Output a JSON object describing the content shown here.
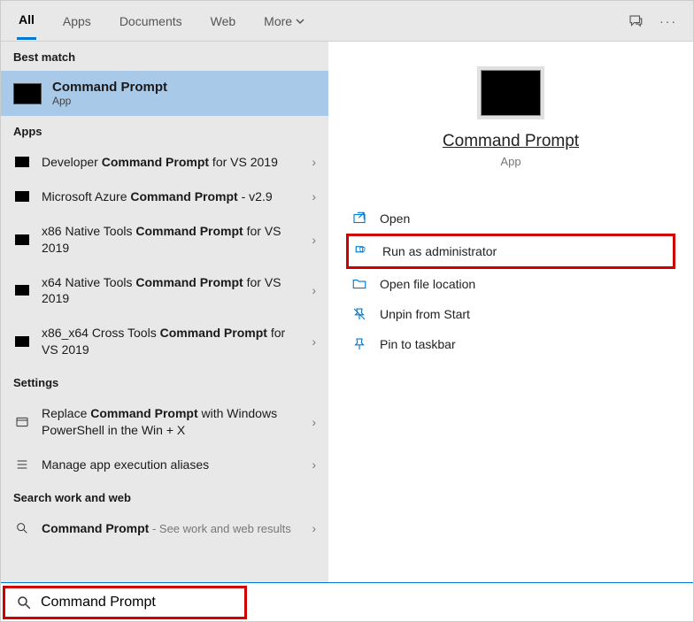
{
  "tabs": {
    "all": "All",
    "apps": "Apps",
    "documents": "Documents",
    "web": "Web",
    "more": "More"
  },
  "sections": {
    "best_match": "Best match",
    "apps": "Apps",
    "settings": "Settings",
    "work_web": "Search work and web"
  },
  "best_match": {
    "title": "Command Prompt",
    "subtitle": "App"
  },
  "app_results": [
    {
      "pre": "Developer ",
      "bold": "Command Prompt",
      "post": " for VS 2019"
    },
    {
      "pre": "Microsoft Azure ",
      "bold": "Command Prompt",
      "post": " - v2.9"
    },
    {
      "pre": "x86 Native Tools ",
      "bold": "Command Prompt",
      "post": " for VS 2019"
    },
    {
      "pre": "x64 Native Tools ",
      "bold": "Command Prompt",
      "post": " for VS 2019"
    },
    {
      "pre": "x86_x64 Cross Tools ",
      "bold": "Command Prompt",
      "post": " for VS 2019"
    }
  ],
  "settings_results": [
    {
      "pre": "Replace ",
      "bold": "Command Prompt",
      "post": " with Windows PowerShell in the Win + X"
    },
    {
      "pre": "Manage app execution aliases",
      "bold": "",
      "post": ""
    }
  ],
  "web_result": {
    "bold": "Command Prompt",
    "suffix": " - See work and web results"
  },
  "search": {
    "value": "Command Prompt"
  },
  "detail": {
    "title": "Command Prompt",
    "subtitle": "App"
  },
  "actions": {
    "open": "Open",
    "run_admin": "Run as administrator",
    "open_loc": "Open file location",
    "unpin": "Unpin from Start",
    "pin_tb": "Pin to taskbar"
  }
}
